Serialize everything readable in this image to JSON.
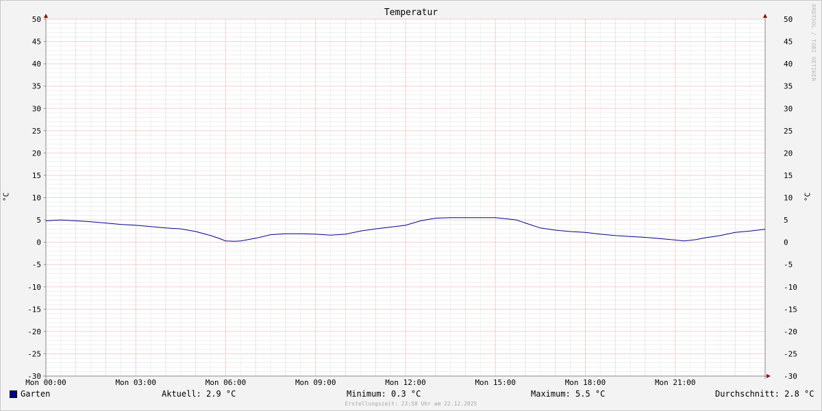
{
  "chart_data": {
    "type": "line",
    "title": "Temperatur",
    "ylabel": "°C",
    "ylim": [
      -30,
      50
    ],
    "yticks": [
      -30,
      -25,
      -20,
      -15,
      -10,
      -5,
      0,
      5,
      10,
      15,
      20,
      25,
      30,
      35,
      40,
      45,
      50
    ],
    "xlim": [
      0,
      24
    ],
    "xticks": [
      {
        "x": 0,
        "label": "Mon 00:00"
      },
      {
        "x": 3,
        "label": "Mon 03:00"
      },
      {
        "x": 6,
        "label": "Mon 06:00"
      },
      {
        "x": 9,
        "label": "Mon 09:00"
      },
      {
        "x": 12,
        "label": "Mon 12:00"
      },
      {
        "x": 15,
        "label": "Mon 15:00"
      },
      {
        "x": 18,
        "label": "Mon 18:00"
      },
      {
        "x": 21,
        "label": "Mon 21:00"
      }
    ],
    "grid": true,
    "series": [
      {
        "name": "Garten",
        "color": "#00008b",
        "x": [
          0,
          0.5,
          1,
          1.5,
          2,
          2.5,
          3,
          3.5,
          4,
          4.5,
          5,
          5.5,
          5.8,
          6,
          6.3,
          6.5,
          7,
          7.5,
          8,
          8.5,
          9,
          9.5,
          10,
          10.5,
          11,
          11.5,
          12,
          12.5,
          13,
          13.5,
          14,
          14.5,
          15,
          15.3,
          15.7,
          16,
          16.5,
          17,
          17.5,
          18,
          18.5,
          19,
          19.5,
          20,
          20.5,
          21,
          21.3,
          21.7,
          22,
          22.5,
          23,
          23.5,
          24
        ],
        "y": [
          4.8,
          5.0,
          4.8,
          4.6,
          4.3,
          4.0,
          3.8,
          3.5,
          3.2,
          3.0,
          2.4,
          1.5,
          0.8,
          0.3,
          0.2,
          0.3,
          0.9,
          1.7,
          1.9,
          1.9,
          1.8,
          1.6,
          1.8,
          2.5,
          3.0,
          3.4,
          3.8,
          4.8,
          5.4,
          5.5,
          5.5,
          5.5,
          5.5,
          5.3,
          5.0,
          4.3,
          3.2,
          2.7,
          2.4,
          2.2,
          1.8,
          1.5,
          1.3,
          1.1,
          0.8,
          0.5,
          0.3,
          0.6,
          1.0,
          1.5,
          2.2,
          2.5,
          2.9
        ]
      }
    ]
  },
  "legend": {
    "name": "Garten",
    "current": "Aktuell: 2.9 °C",
    "minimum": "Minimum: 0.3 °C",
    "maximum": "Maximum: 5.5 °C",
    "average": "Durchschnitt: 2.8 °C"
  },
  "footer": "Erstellungszeit: 23:58 Uhr am 22.12.2025",
  "watermark": "RRDTOOL / TOBI OETIKER"
}
